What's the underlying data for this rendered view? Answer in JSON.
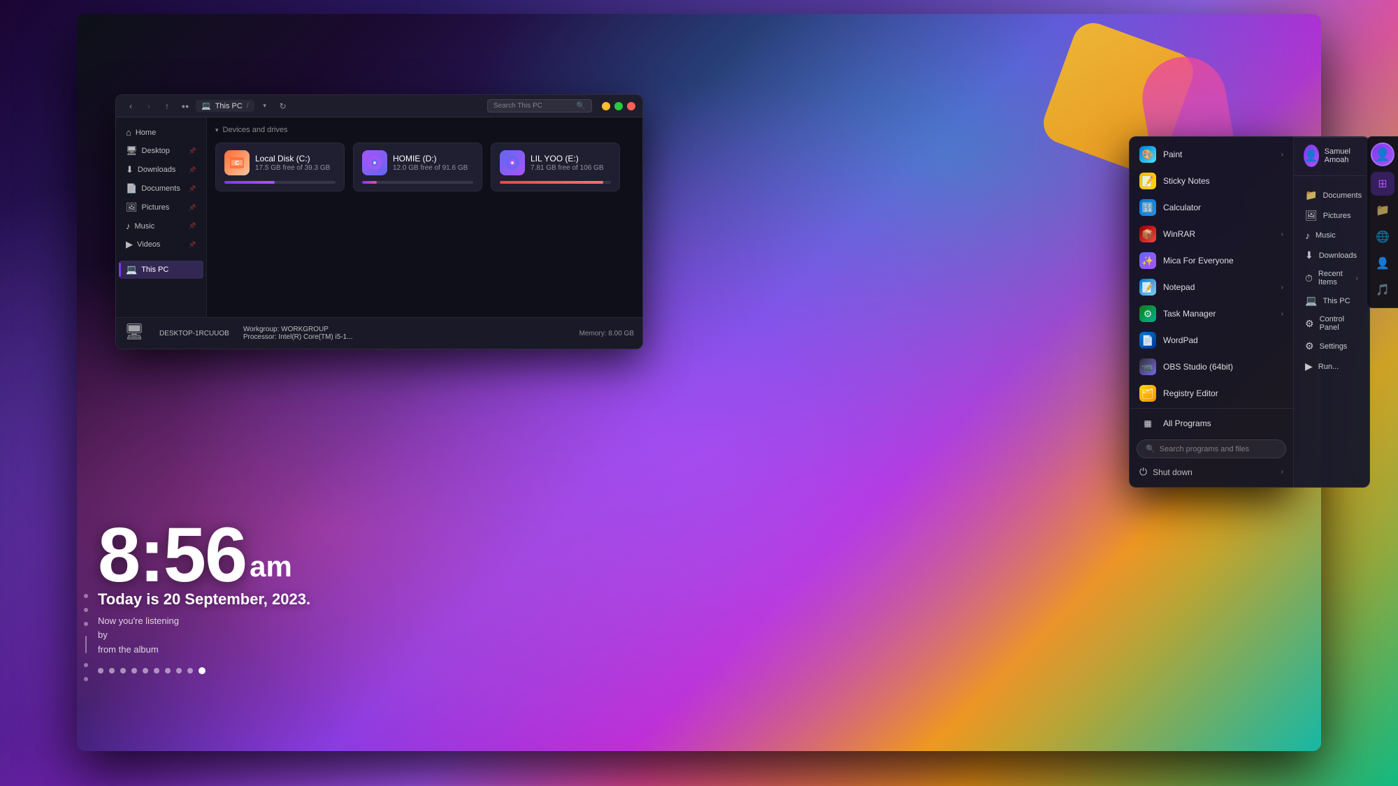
{
  "desktop": {
    "background": "gradient purple-teal"
  },
  "clock": {
    "time": "8:56",
    "period": "am",
    "date": "Today is 20 September, 2023.",
    "music_label": "Now you're listening",
    "music_by": "by",
    "music_from": "from the album"
  },
  "file_explorer": {
    "title": "This PC",
    "path": "This PC",
    "search_placeholder": "Search This PC",
    "section_label": "Devices and drives",
    "drives": [
      {
        "name": "Local Disk (C:)",
        "space": "17.5 GB free of 39.3 GB",
        "fill_pct": 45,
        "type": "c"
      },
      {
        "name": "HOMIE (D:)",
        "space": "12.0 GB free of 91.6 GB",
        "fill_pct": 13,
        "type": "d"
      },
      {
        "name": "LIL YOO (E:)",
        "space": "7.81 GB free of 106 GB",
        "fill_pct": 93,
        "type": "e"
      }
    ],
    "sidebar_items": [
      {
        "label": "Home",
        "icon": "⌂",
        "pinned": false
      },
      {
        "label": "Desktop",
        "icon": "🖥",
        "pinned": true
      },
      {
        "label": "Downloads",
        "icon": "⬇",
        "pinned": true
      },
      {
        "label": "Documents",
        "icon": "📄",
        "pinned": true
      },
      {
        "label": "Pictures",
        "icon": "🖼",
        "pinned": true
      },
      {
        "label": "Music",
        "icon": "♪",
        "pinned": true
      },
      {
        "label": "Videos",
        "icon": "▶",
        "pinned": true
      },
      {
        "label": "This PC",
        "icon": "💻",
        "pinned": false
      }
    ],
    "status": {
      "hostname": "DESKTOP-1RCUUOB",
      "workgroup_label": "Workgroup:",
      "workgroup": "WORKGROUP",
      "processor_label": "Processor:",
      "processor": "Intel(R) Core(TM) i5-1...",
      "memory_label": "Memory:",
      "memory": "8.00 GB"
    }
  },
  "start_menu": {
    "apps": [
      {
        "label": "Paint",
        "icon_class": "icon-paint",
        "icon": "🎨",
        "has_arrow": true
      },
      {
        "label": "Sticky Notes",
        "icon_class": "icon-sticky",
        "icon": "📝",
        "has_arrow": false
      },
      {
        "label": "Calculator",
        "icon_class": "icon-calc",
        "icon": "🔢",
        "has_arrow": false
      },
      {
        "label": "WinRAR",
        "icon_class": "icon-winrar",
        "icon": "📦",
        "has_arrow": true
      },
      {
        "label": "Mica For Everyone",
        "icon_class": "icon-mica",
        "icon": "✨",
        "has_arrow": false
      },
      {
        "label": "Notepad",
        "icon_class": "icon-notepad",
        "icon": "📝",
        "has_arrow": true
      },
      {
        "label": "Task Manager",
        "icon_class": "icon-taskmgr",
        "icon": "⚙",
        "has_arrow": true
      },
      {
        "label": "WordPad",
        "icon_class": "icon-wordpad",
        "icon": "📄",
        "has_arrow": false
      },
      {
        "label": "OBS Studio (64bit)",
        "icon_class": "icon-obs",
        "icon": "📹",
        "has_arrow": false
      },
      {
        "label": "Registry Editor",
        "icon_class": "icon-regedit",
        "icon": "🗂",
        "has_arrow": false
      }
    ],
    "all_programs": "All Programs",
    "search_placeholder": "Search programs and files",
    "shutdown_label": "Shut down",
    "right_items": [
      {
        "label": "Samuel Amoah",
        "icon": "👤"
      },
      {
        "label": "Documents",
        "icon": "📁"
      },
      {
        "label": "Pictures",
        "icon": "🖼"
      },
      {
        "label": "Music",
        "icon": "♪"
      },
      {
        "label": "Downloads",
        "icon": "⬇"
      },
      {
        "label": "Recent Items",
        "icon": "⏱",
        "has_arrow": true
      },
      {
        "label": "This PC",
        "icon": "💻"
      },
      {
        "label": "Control Panel",
        "icon": "⚙"
      },
      {
        "label": "Settings",
        "icon": "⚙"
      },
      {
        "label": "Run...",
        "icon": "▶"
      }
    ]
  },
  "icon_strip": {
    "items": [
      {
        "icon": "👤",
        "type": "user"
      },
      {
        "icon": "⚡",
        "active": true
      },
      {
        "icon": "📁",
        "active": false
      },
      {
        "icon": "🌐",
        "active": false
      },
      {
        "icon": "👤",
        "red": true
      },
      {
        "icon": "🎵",
        "blue": true
      }
    ]
  }
}
